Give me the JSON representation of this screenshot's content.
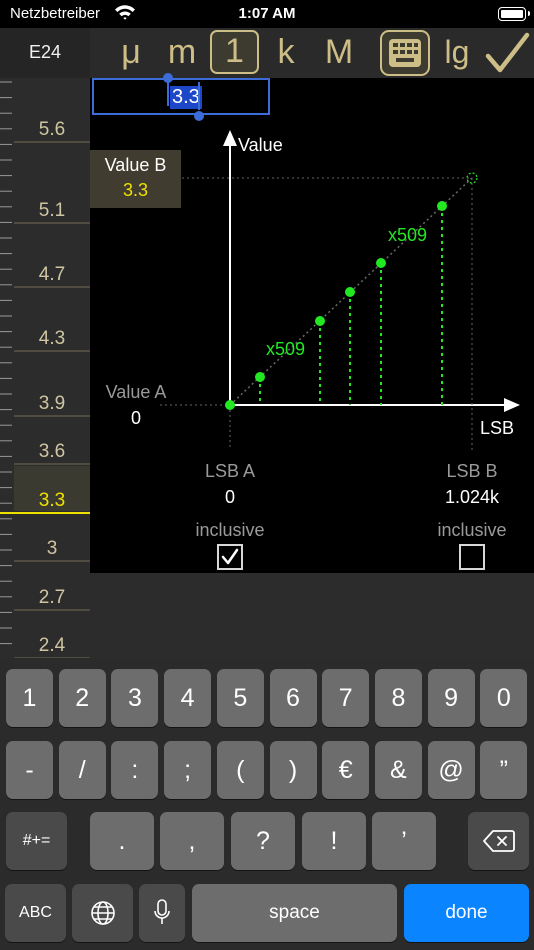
{
  "status_bar": {
    "carrier": "Netzbetreiber",
    "time": "1:07 AM"
  },
  "toolbar": {
    "series": "E24",
    "prefixes": [
      "μ",
      "m",
      "1",
      "k",
      "M"
    ],
    "log_label": "lg",
    "selected_prefix": "1",
    "accent_color": "#cdbd86"
  },
  "ruler": {
    "values": [
      "5.6",
      "5.1",
      "4.7",
      "4.3",
      "3.9",
      "3.6",
      "3.3",
      "3",
      "2.7",
      "2.4"
    ],
    "selected": "3.3"
  },
  "editor": {
    "value": "3.3"
  },
  "graph": {
    "value_b_label": "Value B",
    "value_b": "3.3",
    "value_a_label": "Value A",
    "value_a": "0",
    "y_axis_label": "Value",
    "x_axis_label": "LSB",
    "lsb_a_label": "LSB A",
    "lsb_a": "0",
    "lsb_b_label": "LSB B",
    "lsb_b": "1.024k",
    "step_label_1": "x509",
    "step_label_2": "x509",
    "inclusive_a_label": "inclusive",
    "inclusive_a_checked": true,
    "inclusive_b_label": "inclusive",
    "inclusive_b_checked": false,
    "point_color": "#22e822"
  },
  "keyboard": {
    "row1": [
      "1",
      "2",
      "3",
      "4",
      "5",
      "6",
      "7",
      "8",
      "9",
      "0"
    ],
    "row2": [
      "-",
      "/",
      ":",
      ";",
      "(",
      ")",
      "€",
      "&",
      "@",
      "”"
    ],
    "row3": [
      "#+=",
      ".",
      ",",
      "?",
      "!",
      "’"
    ],
    "abc_label": "ABC",
    "space_label": "space",
    "done_label": "done"
  }
}
